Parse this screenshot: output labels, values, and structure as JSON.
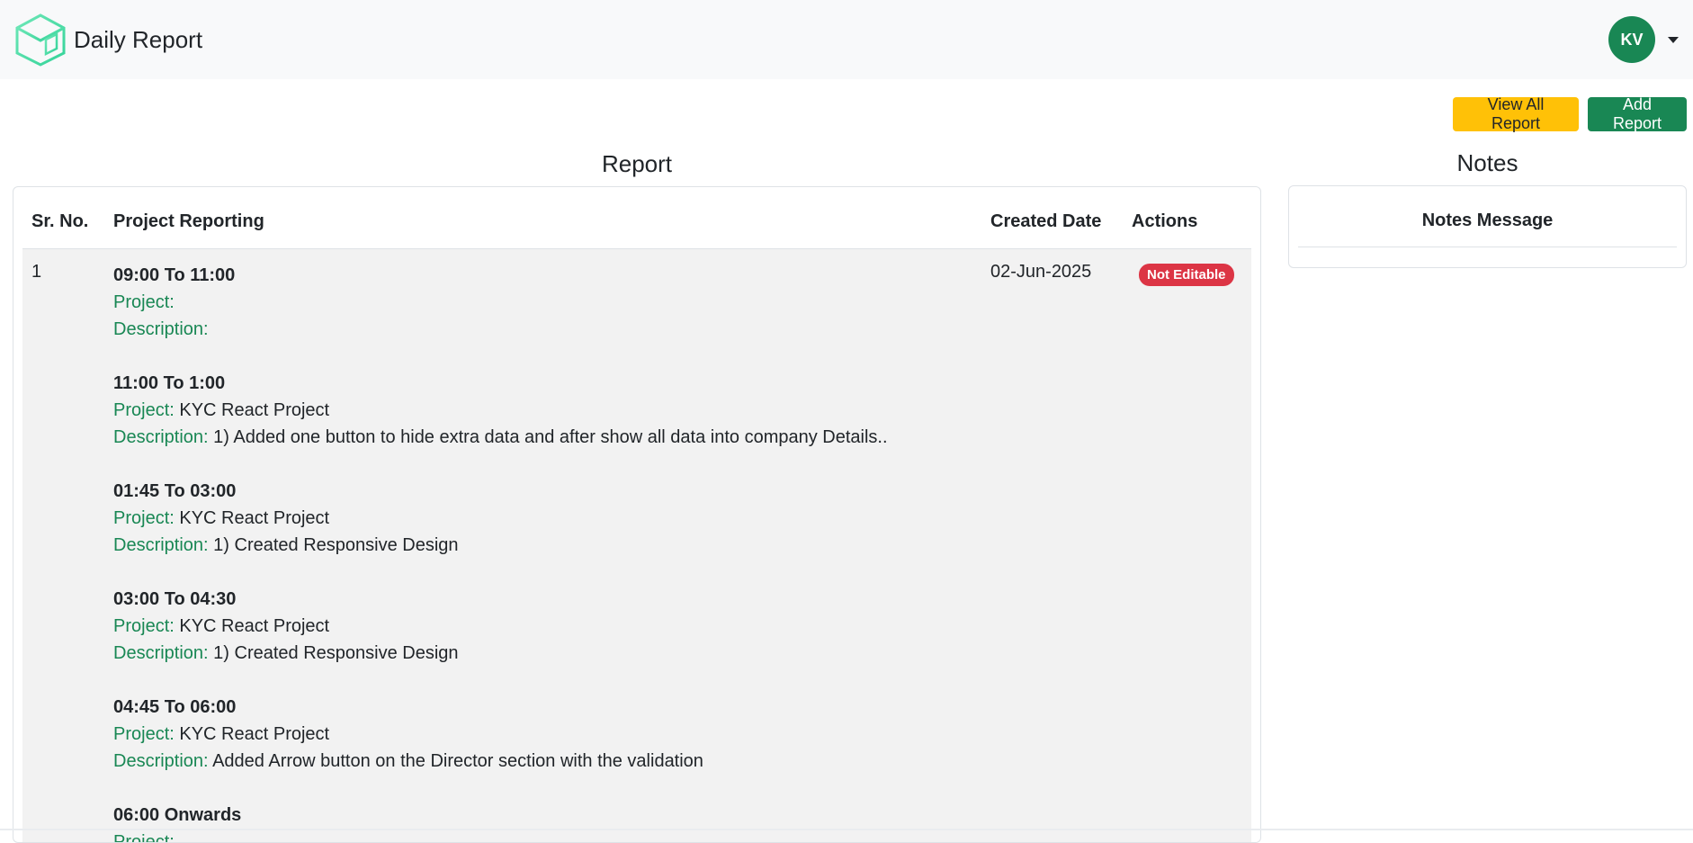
{
  "navbar": {
    "brand_title": "Daily Report",
    "user_initials": "KV",
    "logo_icon": "cube-logo-icon",
    "accent_color": "#198754"
  },
  "actions": {
    "view_all_label": "View All Report",
    "add_label": "Add Report"
  },
  "report": {
    "title": "Report",
    "columns": [
      "Sr. No.",
      "Project Reporting",
      "Created Date",
      "Actions"
    ],
    "rows": [
      {
        "sr_no": "1",
        "created_date": "02-Jun-2025",
        "status_badge": "Not Editable",
        "entries": [
          {
            "time": "09:00 To 11:00",
            "project_label": "Project:",
            "project": "",
            "description_label": "Description:",
            "description": ""
          },
          {
            "time": "11:00 To 1:00",
            "project_label": "Project:",
            "project": "KYC React Project",
            "description_label": "Description:",
            "description": "1) Added one button to hide extra data and after show all data into company Details.."
          },
          {
            "time": "01:45 To 03:00",
            "project_label": "Project:",
            "project": "KYC React Project",
            "description_label": "Description:",
            "description": "1) Created Responsive Design"
          },
          {
            "time": "03:00 To 04:30",
            "project_label": "Project:",
            "project": "KYC React Project",
            "description_label": "Description:",
            "description": "1) Created Responsive Design"
          },
          {
            "time": "04:45 To 06:00",
            "project_label": "Project:",
            "project": "KYC React Project",
            "description_label": "Description:",
            "description": "Added Arrow button on the Director section with the validation"
          },
          {
            "time": "06:00 Onwards",
            "project_label": "Project:",
            "project": "",
            "description_label": "",
            "description": ""
          }
        ]
      }
    ]
  },
  "notes": {
    "title": "Notes",
    "header": "Notes Message"
  }
}
